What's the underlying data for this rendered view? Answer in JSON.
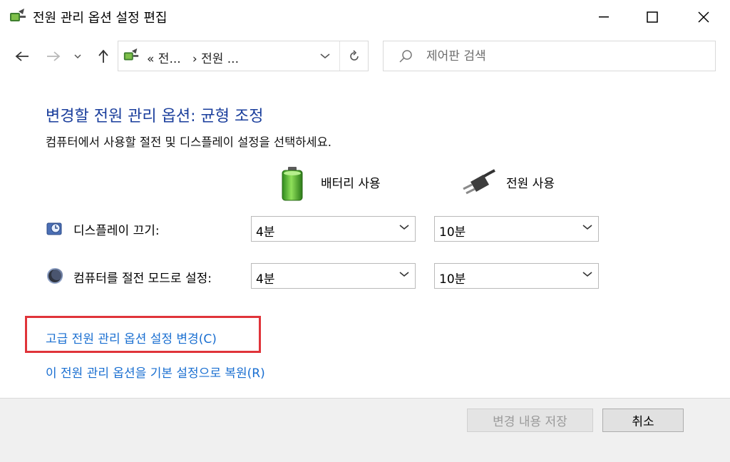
{
  "window": {
    "title": "전원 관리 옵션 설정 편집"
  },
  "address_bar": {
    "crumb1": "«   전...",
    "crumb2": "›   전원 ..."
  },
  "search": {
    "placeholder": "제어판 검색"
  },
  "content": {
    "heading": "변경할 전원 관리 옵션: 균형 조정",
    "subtitle": "컴퓨터에서 사용할 절전 및 디스플레이 설정을 선택하세요.",
    "columns": {
      "battery": "배터리 사용",
      "plugged": "전원 사용"
    },
    "rows": [
      {
        "label": "디스플레이 끄기:",
        "battery_value": "4분",
        "plugged_value": "10분"
      },
      {
        "label": "컴퓨터를 절전 모드로 설정:",
        "battery_value": "4분",
        "plugged_value": "10분"
      }
    ],
    "links": {
      "advanced": "고급 전원 관리 옵션 설정 변경(C)",
      "restore": "이 전원 관리 옵션을 기본 설정으로 복원(R)"
    }
  },
  "buttons": {
    "save": "변경 내용 저장",
    "cancel": "취소"
  },
  "colors": {
    "heading": "#1a3e9c",
    "link": "#1a6fd1",
    "highlight": "#e0343a",
    "footer": "#f0f0f0"
  }
}
